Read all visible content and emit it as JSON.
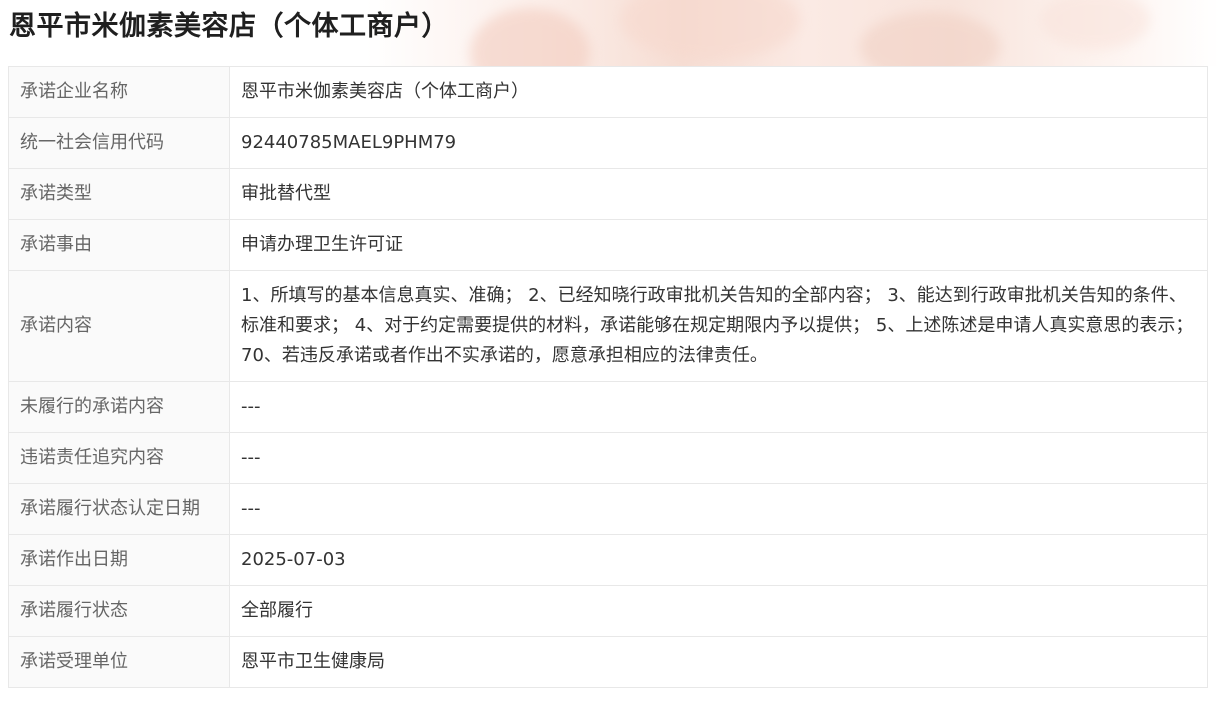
{
  "page": {
    "title": "恩平市米伽素美容店（个体工商户）"
  },
  "rows": [
    {
      "label": "承诺企业名称",
      "value": "恩平市米伽素美容店（个体工商户）"
    },
    {
      "label": "统一社会信用代码",
      "value": "92440785MAEL9PHM79"
    },
    {
      "label": "承诺类型",
      "value": "审批替代型"
    },
    {
      "label": "承诺事由",
      "value": "申请办理卫生许可证"
    },
    {
      "label": "承诺内容",
      "value": "1、所填写的基本信息真实、准确； 2、已经知晓行政审批机关告知的全部内容； 3、能达到行政审批机关告知的条件、标准和要求； 4、对于约定需要提供的材料，承诺能够在规定期限内予以提供； 5、上述陈述是申请人真实意思的表示； 70、若违反承诺或者作出不实承诺的，愿意承担相应的法律责任。"
    },
    {
      "label": "未履行的承诺内容",
      "value": "---"
    },
    {
      "label": "违诺责任追究内容",
      "value": "---"
    },
    {
      "label": "承诺履行状态认定日期",
      "value": "---"
    },
    {
      "label": "承诺作出日期",
      "value": "2025-07-03"
    },
    {
      "label": "承诺履行状态",
      "value": "全部履行"
    },
    {
      "label": "承诺受理单位",
      "value": "恩平市卫生健康局"
    }
  ]
}
